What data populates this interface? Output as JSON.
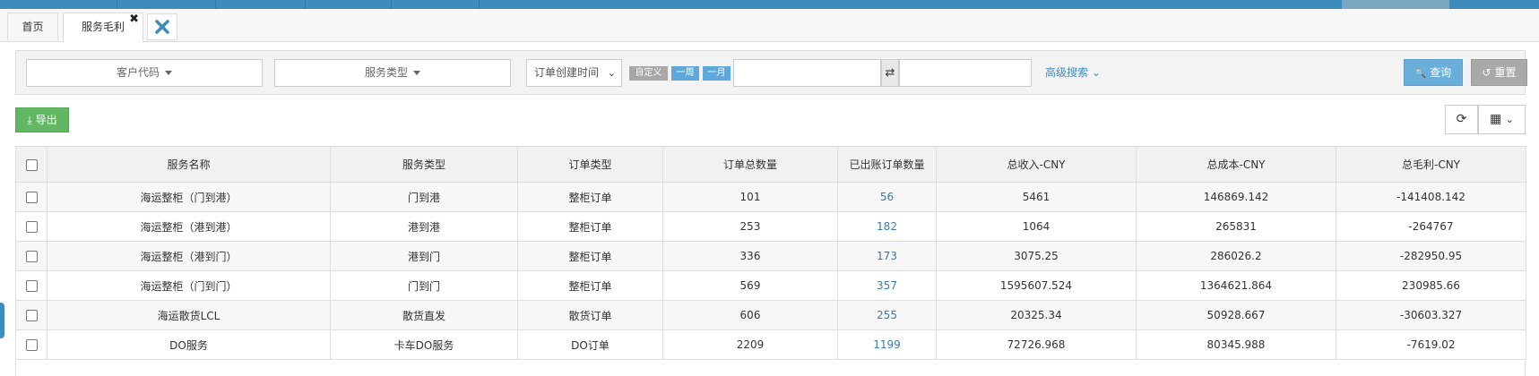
{
  "colors": {
    "topbar": "#3c8dbc",
    "link": "#337ab7",
    "query": "#6aafda",
    "reset": "#a9a9a9",
    "export": "#62b862"
  },
  "tabs": [
    {
      "label": "首页",
      "active": false
    },
    {
      "label": "服务毛利",
      "active": true,
      "close": "✖"
    }
  ],
  "tab_close_all": {
    "icon": "close-all-icon"
  },
  "filters": {
    "customer_code": "客户代码",
    "service_type": "服务类型",
    "date_type": "订单创建时间",
    "date_type_chevron": "⌄",
    "quick_custom": "自定义",
    "quick_week": "一周",
    "quick_month": "一月",
    "swap": "⇄",
    "advanced": "高级搜索",
    "advanced_chevron": "⌄",
    "query": "查询",
    "query_icon": "🔍",
    "reset": "重置",
    "reset_icon": "↺"
  },
  "toolbar": {
    "export": "导出",
    "export_icon": "⤓",
    "refresh_icon": "⟳",
    "columns_icon": "▦",
    "columns_chevron": "⌄"
  },
  "table": {
    "headers": [
      "服务名称",
      "服务类型",
      "订单类型",
      "订单总数量",
      "已出账订单数量",
      "总收入-CNY",
      "总成本-CNY",
      "总毛利-CNY"
    ],
    "rows": [
      [
        "海运整柜（门到港）",
        "门到港",
        "整柜订单",
        "101",
        "56",
        "5461",
        "146869.142",
        "-141408.142"
      ],
      [
        "海运整柜（港到港）",
        "港到港",
        "整柜订单",
        "253",
        "182",
        "1064",
        "265831",
        "-264767"
      ],
      [
        "海运整柜（港到门）",
        "港到门",
        "整柜订单",
        "336",
        "173",
        "3075.25",
        "286026.2",
        "-282950.95"
      ],
      [
        "海运整柜（门到门）",
        "门到门",
        "整柜订单",
        "569",
        "357",
        "1595607.524",
        "1364621.864",
        "230985.66"
      ],
      [
        "海运散货LCL",
        "散货直发",
        "散货订单",
        "606",
        "255",
        "20325.34",
        "50928.667",
        "-30603.327"
      ],
      [
        "DO服务",
        "卡车DO服务",
        "DO订单",
        "2209",
        "1199",
        "72726.968",
        "80345.988",
        "-7619.02"
      ]
    ]
  }
}
